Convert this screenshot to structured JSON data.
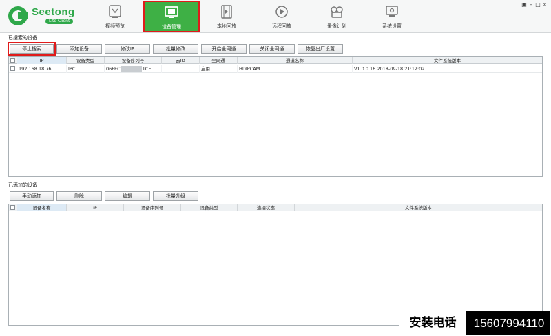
{
  "app": {
    "logo_name": "Seetong",
    "logo_sub": "Lite Client",
    "win_controls": [
      "▣",
      "-",
      "□",
      "×"
    ]
  },
  "nav": [
    {
      "label": "视频预览",
      "icon": "video-preview-icon"
    },
    {
      "label": "设备管理",
      "icon": "device-manage-icon",
      "active": true
    },
    {
      "label": "本地回放",
      "icon": "local-playback-icon"
    },
    {
      "label": "远程回放",
      "icon": "remote-playback-icon"
    },
    {
      "label": "录像计划",
      "icon": "record-plan-icon"
    },
    {
      "label": "系统设置",
      "icon": "system-settings-icon"
    }
  ],
  "searched": {
    "title": "已搜索的设备",
    "buttons": [
      "停止搜索",
      "添加设备",
      "修改IP",
      "批量修改",
      "开启全网通",
      "关闭全网通",
      "恢复出厂设置"
    ],
    "columns": [
      "IP",
      "设备类型",
      "设备序列号",
      "云ID",
      "全网通",
      "通道名称",
      "文件系统版本"
    ],
    "rows": [
      {
        "ip": "192.168.18.76",
        "type": "IPC",
        "serial_start": "06FEC",
        "serial_end": "1CE",
        "cloud_id": "",
        "all_net": "启用",
        "channel": "HDIPCAM",
        "fs_version": "V1.0.0.16 2018-09-18 21:12:02"
      }
    ]
  },
  "added": {
    "title": "已添加的设备",
    "buttons": [
      "手动添加",
      "删除",
      "编辑",
      "批量升级"
    ],
    "columns": [
      "设备名称",
      "IP",
      "设备序列号",
      "设备类型",
      "连接状态",
      "文件系统版本"
    ]
  },
  "phone_banner": {
    "label": "安装电话",
    "number": "15607994110"
  },
  "colors": {
    "brand_green": "#2fa84a",
    "active_tab": "#3eb045",
    "highlight_red": "#e01b1b"
  }
}
